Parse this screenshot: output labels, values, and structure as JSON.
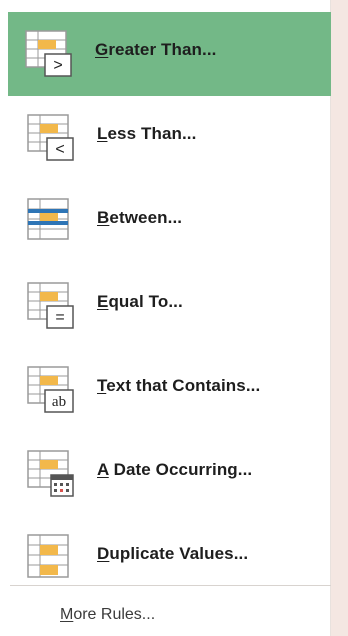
{
  "menu": {
    "items": [
      {
        "icon": "greater-than-icon",
        "access_key": "G",
        "rest": "reater Than...",
        "selected": true
      },
      {
        "icon": "less-than-icon",
        "access_key": "L",
        "rest": "ess Than...",
        "selected": false
      },
      {
        "icon": "between-icon",
        "access_key": "B",
        "rest": "etween...",
        "selected": false
      },
      {
        "icon": "equal-to-icon",
        "access_key": "E",
        "rest": "qual To...",
        "selected": false
      },
      {
        "icon": "text-contains-icon",
        "access_key": "T",
        "rest": "ext that Contains...",
        "selected": false
      },
      {
        "icon": "date-occurring-icon",
        "access_key": "A",
        "rest": " Date Occurring...",
        "selected": false
      },
      {
        "icon": "duplicate-values-icon",
        "access_key": "D",
        "rest": "uplicate Values...",
        "selected": false
      }
    ],
    "more_rules": {
      "access_key": "M",
      "rest": "ore Rules..."
    },
    "icon_text": {
      "greater": ">",
      "less": "<",
      "equal": "=",
      "text": "ab"
    }
  },
  "colors": {
    "selected_bg": "#73b887",
    "highlight_yellow": "#f2b84b",
    "highlight_blue": "#2e75b6",
    "grid_line": "#9a9a9a"
  }
}
